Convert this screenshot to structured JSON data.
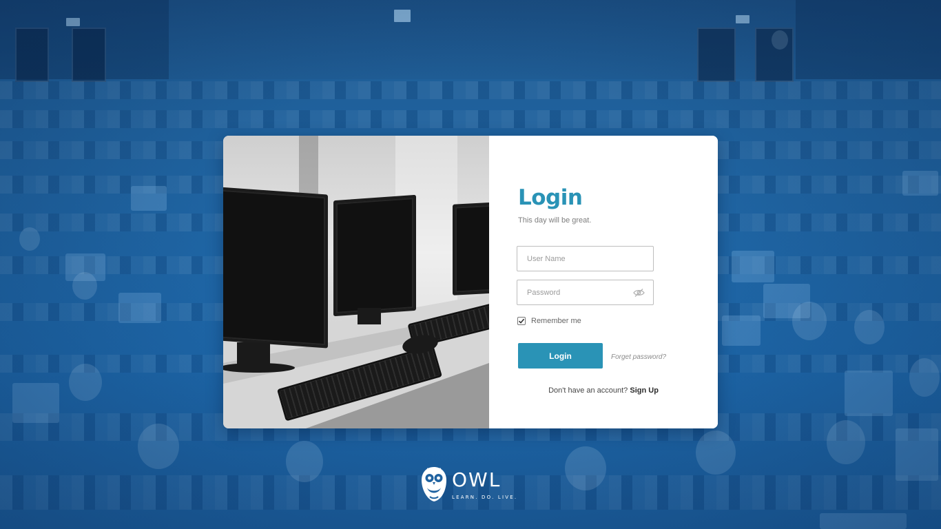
{
  "colors": {
    "accent": "#2a93b6",
    "background_tint": "#1f63a0",
    "card": "#ffffff"
  },
  "login": {
    "title": "Login",
    "subtitle": "This day will be great.",
    "username_placeholder": "User Name",
    "username_value": "",
    "password_placeholder": "Password",
    "password_value": "",
    "password_toggle_icon": "eye-icon",
    "remember_label": "Remember me",
    "remember_checked": true,
    "login_button": "Login",
    "forgot_link": "Forget password?",
    "signup_prompt": "Don't have an account?",
    "signup_link": "Sign Up"
  },
  "brand": {
    "name": "OWL",
    "tagline": "LEARN. DO. LIVE."
  }
}
